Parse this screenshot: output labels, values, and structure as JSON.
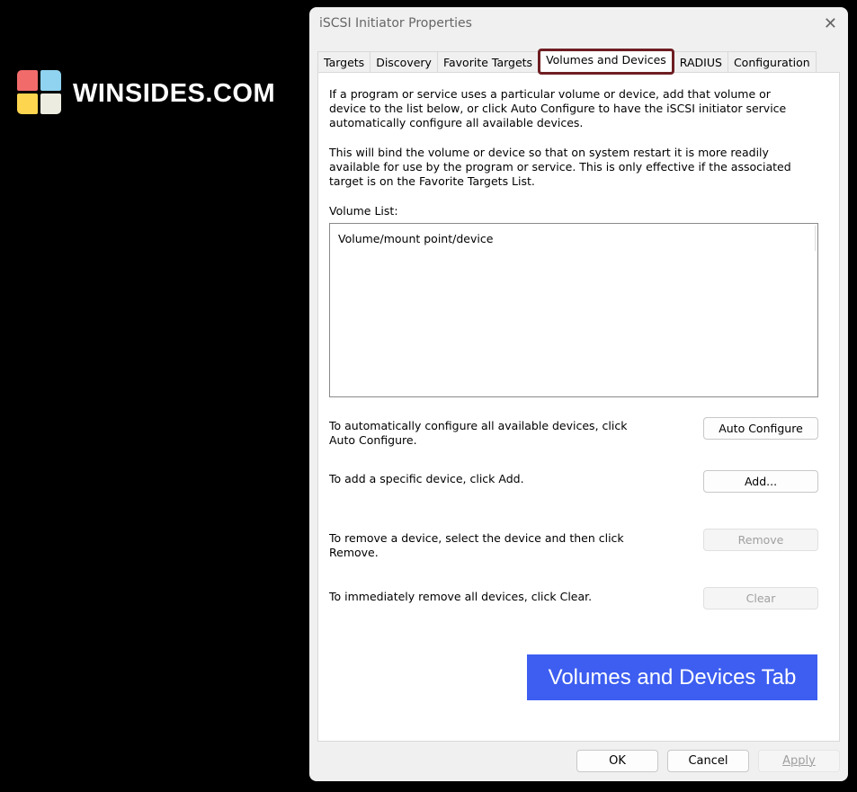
{
  "logo": {
    "text": "WINSIDES.COM",
    "colors": [
      "#f26b6b",
      "#8fd3f0",
      "#fdd54f",
      "#ecece0"
    ]
  },
  "dialog": {
    "title": "iSCSI Initiator Properties",
    "close_icon": "close-icon"
  },
  "tabs": [
    "Targets",
    "Discovery",
    "Favorite Targets",
    "Volumes and Devices",
    "RADIUS",
    "Configuration"
  ],
  "active_tab": "Volumes and Devices",
  "panel": {
    "intro1": "If a program or service uses a particular volume or device, add that volume or device to the list below, or click Auto Configure to have the iSCSI initiator service automatically configure all available devices.",
    "intro2": "This will bind the volume or device so that on system restart it is more readily available for use by the program or service.  This is only effective if the associated target is on the Favorite Targets List.",
    "volume_list_label": "Volume List:",
    "volume_list_header": "Volume/mount point/device",
    "auto_text": "To automatically configure all available devices, click Auto Configure.",
    "auto_button": "Auto Configure",
    "add_text": "To add a specific device, click Add.",
    "add_button": "Add...",
    "remove_text": "To remove a device, select the device and then click Remove.",
    "remove_button": "Remove",
    "clear_text": "To immediately remove all devices, click Clear.",
    "clear_button": "Clear",
    "banner": "Volumes and Devices Tab"
  },
  "footer": {
    "ok": "OK",
    "cancel": "Cancel",
    "apply": "Apply"
  }
}
